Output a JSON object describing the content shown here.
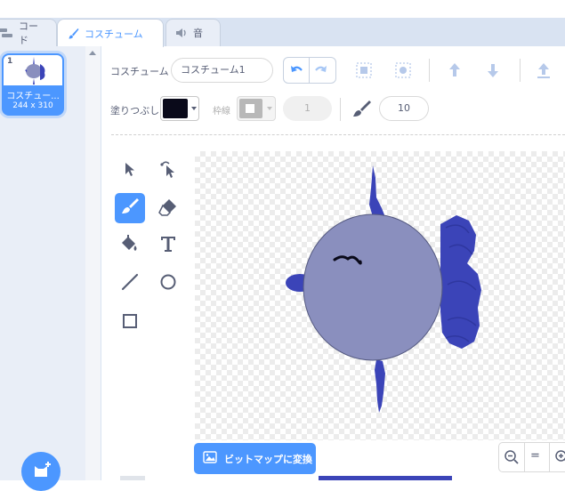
{
  "tabs": [
    {
      "label": "コード",
      "icon": "code-blocks-icon"
    },
    {
      "label": "コスチューム",
      "icon": "paintbrush-icon"
    },
    {
      "label": "音",
      "icon": "speaker-icon"
    }
  ],
  "costume_list": {
    "items": [
      {
        "number": "1",
        "name": "コスチュー...",
        "size": "244 x 310"
      }
    ]
  },
  "toolbar": {
    "costume_label": "コスチューム",
    "costume_name_value": "コスチューム1",
    "fill_label": "塗りつぶし",
    "fill_color": "#0a0a1a",
    "outline_label": "枠線",
    "outline_width_value": "1",
    "brush_size_value": "10"
  },
  "tools": [
    {
      "name": "select-tool",
      "icon": "arrow-select-icon",
      "active": false
    },
    {
      "name": "reshape-tool",
      "icon": "reshape-icon",
      "active": false
    },
    {
      "name": "brush-tool",
      "icon": "brush-icon",
      "active": true
    },
    {
      "name": "eraser-tool",
      "icon": "eraser-icon",
      "active": false
    },
    {
      "name": "fill-tool",
      "icon": "paint-bucket-icon",
      "active": false
    },
    {
      "name": "text-tool",
      "icon": "text-icon",
      "active": false
    },
    {
      "name": "line-tool",
      "icon": "line-icon",
      "active": false
    },
    {
      "name": "circle-tool",
      "icon": "circle-icon",
      "active": false
    },
    {
      "name": "rectangle-tool",
      "icon": "rectangle-icon",
      "active": false
    }
  ],
  "canvas": {
    "body_color": "#8a8fbe",
    "fin_color": "#3b44b8",
    "mouth_color": "#3b44b8"
  },
  "bottom": {
    "convert_label": "ビットマップに変換",
    "zoom_reset_label": "="
  },
  "colors": {
    "accent": "#4c97ff",
    "tab_bar": "#d9e3f2"
  }
}
